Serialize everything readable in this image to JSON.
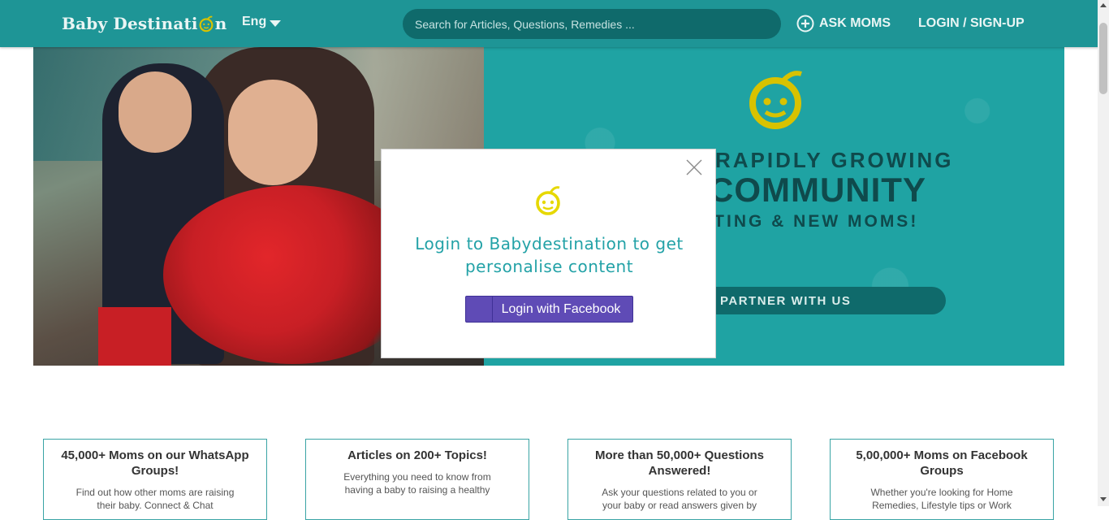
{
  "header": {
    "brand_prefix": "Baby Destinati",
    "brand_suffix": "n",
    "language": "Eng",
    "search_placeholder": "Search for Articles, Questions, Remedies ...",
    "ask_moms": "ASK MOMS",
    "login_signup": "LOGIN / SIGN-UP",
    "colors": {
      "bar": "#1e9596",
      "search_bg": "#0f6a6b",
      "logo_yellow": "#d8c200"
    }
  },
  "hero": {
    "line1": "RAPIDLY GROWING",
    "line2": "COMMUNITY",
    "line3": "CTING & NEW MOMS!",
    "partner_button": "PARTNER WITH US"
  },
  "modal": {
    "message": "Login to Babydestination to get personalise content",
    "facebook_button": "Login with Facebook",
    "colors": {
      "message": "#23a2a7",
      "facebook": "#5f4bb6"
    }
  },
  "cards": [
    {
      "title": "45,000+ Moms on our WhatsApp Groups!",
      "desc": "Find out how other moms are raising their baby. Connect & Chat"
    },
    {
      "title": "Articles on 200+ Topics!",
      "desc": "Everything you need to know from having a baby to raising a healthy"
    },
    {
      "title": "More than 50,000+ Questions Answered!",
      "desc": "Ask your questions related to you or your baby or read answers given by"
    },
    {
      "title": "5,00,000+ Moms on Facebook Groups",
      "desc": "Whether you're looking for Home Remedies, Lifestyle tips or Work"
    }
  ]
}
